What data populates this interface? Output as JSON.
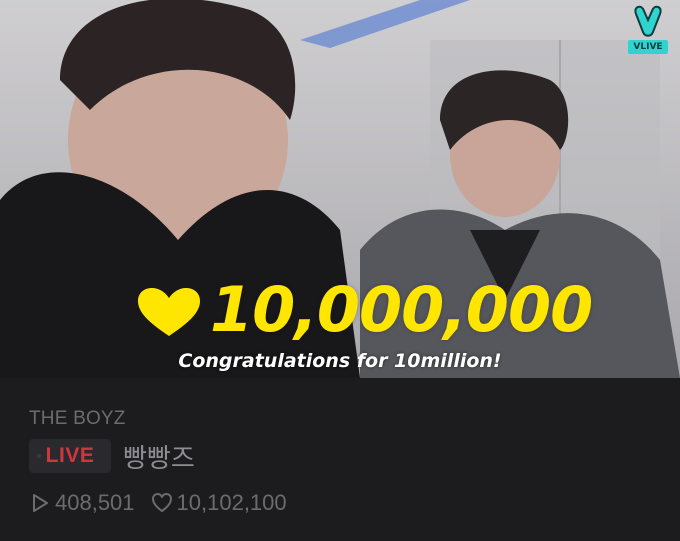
{
  "video": {
    "logo_text": "VLIVE",
    "milestone_count": "10,000,000",
    "congrats_text": "Congratulations for 10million!"
  },
  "info": {
    "channel_name": "THE BOYZ",
    "live_label": "LIVE",
    "broadcast_title": "빵빵즈",
    "play_count": "408,501",
    "like_count": "10,102,100"
  },
  "icons": {
    "logo": "v-hand-icon",
    "milestone": "heart-icon",
    "plays": "play-icon",
    "likes": "heart-outline-icon"
  },
  "colors": {
    "accent_yellow": "#ffe600",
    "vlive_teal": "#2fd3cf",
    "live_red": "#d1363f",
    "background": "#1c1c1f"
  }
}
